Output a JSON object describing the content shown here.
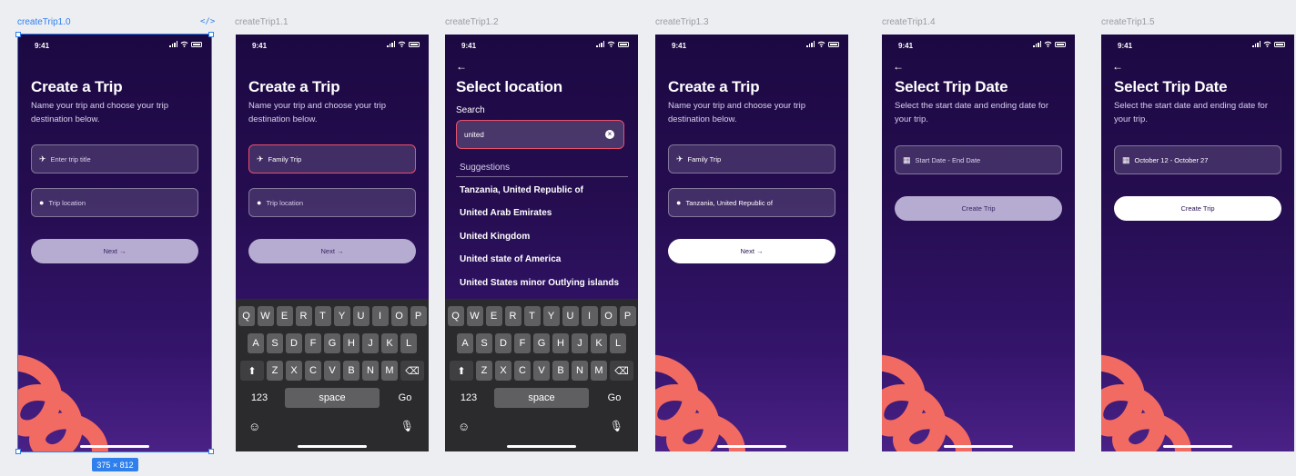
{
  "frames": [
    {
      "name": "createTrip1.0",
      "selected": true
    },
    {
      "name": "createTrip1.1"
    },
    {
      "name": "createTrip1.2"
    },
    {
      "name": "createTrip1.3"
    },
    {
      "name": "createTrip1.4"
    },
    {
      "name": "createTrip1.5"
    }
  ],
  "code_icon": "</>",
  "size_badge": "375 × 812",
  "status_time": "9:41",
  "trip": {
    "title": "Create a Trip",
    "subtitle": "Name your trip and choose your trip destination below.",
    "title_placeholder": "Enter trip title",
    "location_placeholder": "Trip location",
    "title_value": "Family Trip",
    "location_value": "Tanzania, United Republic of",
    "next_label": "Next →"
  },
  "location": {
    "title": "Select location",
    "search_label": "Search",
    "search_value": "united",
    "suggestions_label": "Suggestions",
    "suggestions": [
      "Tanzania, United Republic of",
      "United Arab Emirates",
      "United Kingdom",
      "United state of  America",
      "United States minor Outlying islands"
    ]
  },
  "date": {
    "title": "Select Trip Date",
    "subtitle": "Select the start date and ending date for your trip.",
    "placeholder": "Start Date - End Date",
    "value": "October 12  - October 27",
    "create_label": "Create Trip"
  },
  "keyboard": {
    "row1": [
      "Q",
      "W",
      "E",
      "R",
      "T",
      "Y",
      "U",
      "I",
      "O",
      "P"
    ],
    "row2": [
      "A",
      "S",
      "D",
      "F",
      "G",
      "H",
      "J",
      "K",
      "L"
    ],
    "row3": [
      "Z",
      "X",
      "C",
      "V",
      "B",
      "N",
      "M"
    ],
    "num_label": "123",
    "space_label": "space",
    "go_label": "Go"
  },
  "colors": {
    "accent": "#2f80ed",
    "swirl": "#f26b62",
    "active_border": "#e8506e"
  }
}
